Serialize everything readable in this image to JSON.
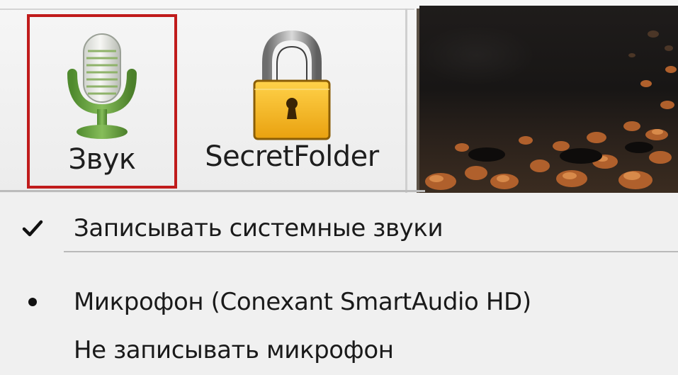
{
  "toolbar": {
    "sound_button": {
      "label": "Звук",
      "icon": "microphone-icon",
      "highlighted": true,
      "highlight_color": "#c01b1b"
    },
    "secret_folder_button": {
      "label": "SecretFolder",
      "icon": "padlock-icon"
    }
  },
  "preview": {
    "icon": "rocky-terrain-image"
  },
  "menu": {
    "items": [
      {
        "label": "Записывать системные звуки",
        "mark": "checkmark",
        "checked": true
      },
      {
        "label": "Микрофон (Conexant SmartAudio HD)",
        "mark": "bullet",
        "selected": true
      },
      {
        "label": "Не записывать микрофон",
        "mark": "none",
        "selected": false
      }
    ]
  },
  "colors": {
    "highlight_border": "#c01b1b",
    "mic_green": "#6aa043",
    "lock_gold": "#f2b51c"
  }
}
